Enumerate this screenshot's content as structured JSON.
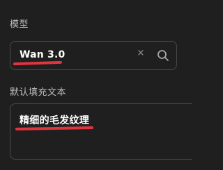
{
  "model": {
    "label": "模型",
    "value": "Wan 3.0",
    "clear_icon": "close-icon",
    "search_icon": "search-icon"
  },
  "default_fill": {
    "label": "默认填充文本",
    "value": "精细的毛发纹理"
  },
  "colors": {
    "background": "#1f1f1f",
    "border": "#4a4a4a",
    "annotation_underline": "#e0343f"
  }
}
